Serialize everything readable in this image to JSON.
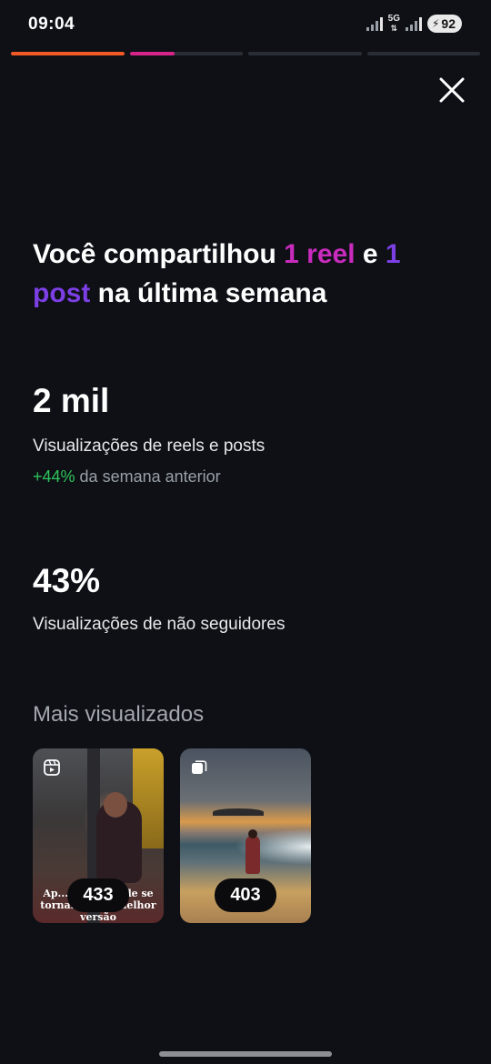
{
  "status_bar": {
    "time": "09:04",
    "network": "5G",
    "battery": "92"
  },
  "story_progress": [
    {
      "fill": 1.0,
      "color": "#f15a24"
    },
    {
      "fill": 1.0,
      "color": "#d6248b"
    },
    {
      "fill": 0.0,
      "color": "#2a2d35"
    },
    {
      "fill": 0.0,
      "color": "#2a2d35"
    }
  ],
  "headline": {
    "part1": "Você compartilhou ",
    "reel": "1 reel",
    "part2": " e ",
    "post": "1 post",
    "part3": " na última semana"
  },
  "views": {
    "value": "2 mil",
    "label": "Visualizações de reels e posts",
    "change_pct": "+44%",
    "change_text": " da semana anterior"
  },
  "non_followers": {
    "value": "43%",
    "label": "Visualizações de não seguidores"
  },
  "most_viewed": {
    "title": "Mais visualizados",
    "items": [
      {
        "type": "reel-icon",
        "count": "433",
        "caption": "Ap... processo de se tornar ... sua melhor versão"
      },
      {
        "type": "carousel-icon",
        "count": "403"
      }
    ]
  },
  "colors": {
    "background": "#0e1016",
    "reel_accent": "#c92bbd",
    "post_accent": "#7b3fe4",
    "positive": "#2ec55a"
  }
}
